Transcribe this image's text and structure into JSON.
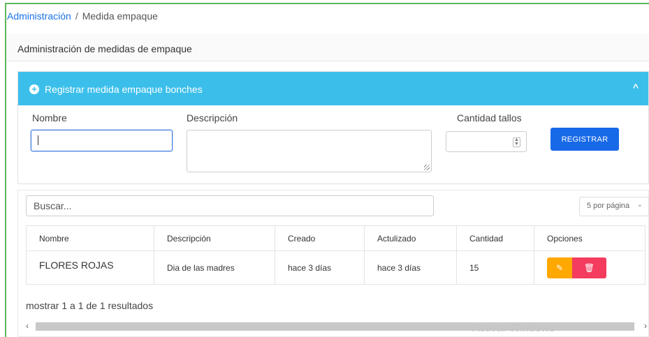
{
  "breadcrumb": {
    "root": "Administración",
    "separator": "/",
    "current": "Medida empaque"
  },
  "page": {
    "title": "Administración de medidas de empaque"
  },
  "form": {
    "header": "Registrar medida empaque bonches",
    "plus_icon": "+",
    "chevron_icon": "^",
    "nombre_label": "Nombre",
    "nombre_value": "",
    "descripcion_label": "Descripción",
    "descripcion_value": "",
    "cantidad_label": "Cantidad tallos",
    "cantidad_value": "",
    "register_button": "REGISTRAR"
  },
  "table": {
    "search_placeholder": "Buscar...",
    "per_page": "5 por página",
    "columns": [
      "Nombre",
      "Descripción",
      "Creado",
      "Actulizado",
      "Cantidad",
      "Opciones"
    ],
    "rows": [
      {
        "nombre": "FLORES ROJAS",
        "descripcion": "Dia de las madres",
        "creado": "hace 3 días",
        "actualizado": "hace 3 días",
        "cantidad": "15"
      }
    ],
    "edit_icon": "✎",
    "delete_icon": "🗑",
    "results": "mostrar 1 a 1 de 1 resultados"
  },
  "colors": {
    "header_bg": "#3bbfea",
    "primary": "#1769e8",
    "edit": "#ffa800",
    "delete": "#f33c5e"
  },
  "watermark": "Activar Windows"
}
